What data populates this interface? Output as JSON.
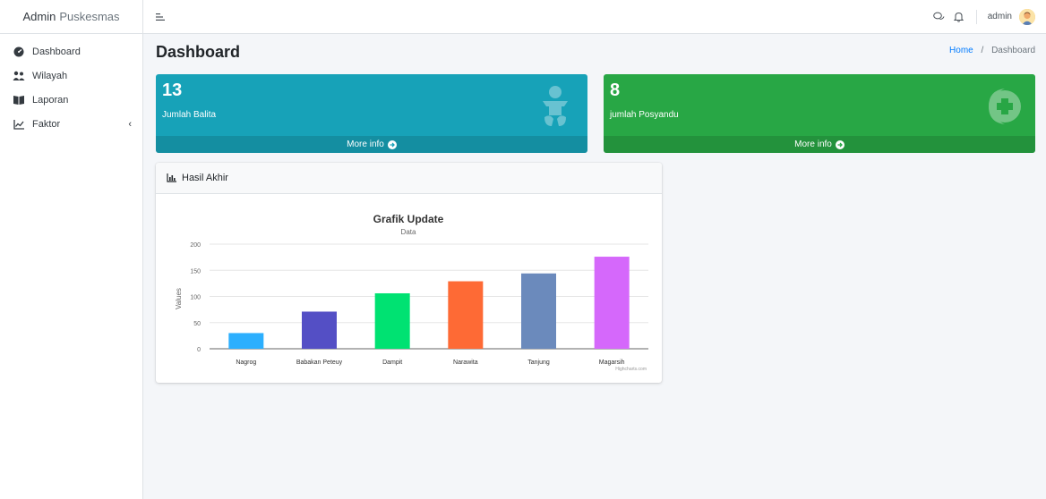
{
  "brand": {
    "part1": "Admin",
    "part2": "Puskesmas"
  },
  "sidebar": {
    "items": [
      {
        "label": "Dashboard",
        "icon": "tachometer-icon"
      },
      {
        "label": "Wilayah",
        "icon": "users-icon"
      },
      {
        "label": "Laporan",
        "icon": "book-icon"
      },
      {
        "label": "Faktor",
        "icon": "chart-line-icon",
        "chevron": "‹"
      }
    ]
  },
  "topbar": {
    "user": "admin"
  },
  "page": {
    "title": "Dashboard"
  },
  "breadcrumb": {
    "home": "Home",
    "slash": "/",
    "current": "Dashboard"
  },
  "boxes": [
    {
      "value": "13",
      "label": "Jumlah Balita",
      "footer": "More info",
      "color": "#17a2b8"
    },
    {
      "value": "8",
      "label": "jumlah Posyandu",
      "footer": "More info",
      "color": "#28a745"
    }
  ],
  "card": {
    "title": "Hasil Akhir"
  },
  "chart_data": {
    "type": "bar",
    "title": "Grafik Update",
    "subtitle": "Data",
    "ylabel": "Values",
    "xlabel": "",
    "ylim": [
      0,
      200
    ],
    "yticks": [
      0,
      50,
      100,
      150,
      200
    ],
    "grid": true,
    "categories": [
      "Nagrog",
      "Babakan Peteuy",
      "Dampit",
      "Narawita",
      "Tanjung",
      "Magarsih"
    ],
    "values": [
      30,
      71,
      106,
      129,
      144,
      176
    ],
    "colors": [
      "#2caffe",
      "#544fc5",
      "#00e272",
      "#fe6a35",
      "#6b8abc",
      "#d568fb"
    ],
    "credits": "Highcharts.com"
  }
}
